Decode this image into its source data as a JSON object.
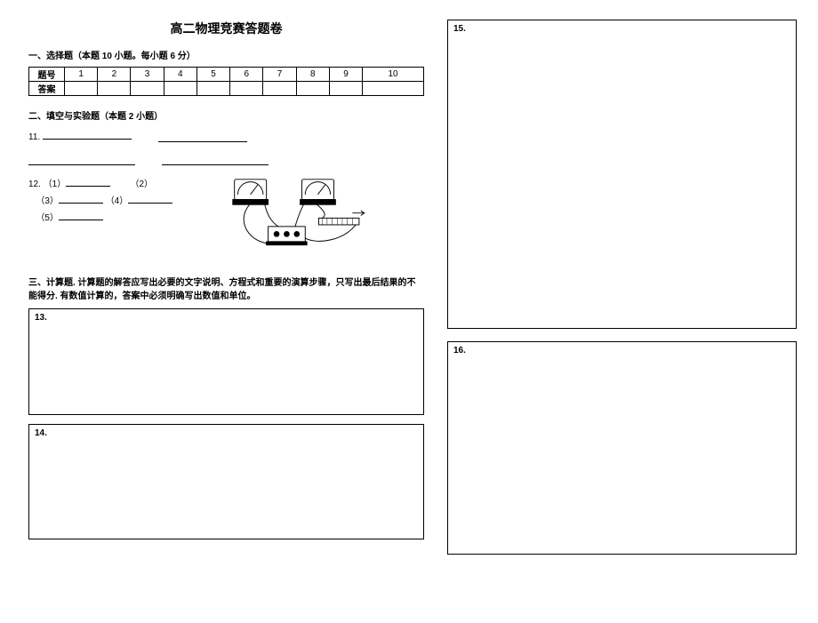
{
  "title": "高二物理竞赛答题卷",
  "section1": {
    "heading": "一、选择题（本题 10 小题。每小题 6 分）",
    "row_label": "题号",
    "answer_label": "答案",
    "cols": [
      "1",
      "2",
      "3",
      "4",
      "5",
      "6",
      "7",
      "8",
      "9",
      "10"
    ]
  },
  "section2": {
    "heading": "二、填空与实验题（本题 2 小题）",
    "q11_label": "11.",
    "q12": {
      "label": "12.",
      "p1": "（1）",
      "p2": "（2）",
      "p3": "（3）",
      "p4": "（4）",
      "p5": "（5）"
    }
  },
  "section3": {
    "heading": "三、计算题. 计算题的解答应写出必要的文字说明、方程式和重要的演算步骤，只写出最后结果的不能得分. 有数值计算的，答案中必须明确写出数值和单位。",
    "q13": "13.",
    "q14": "14.",
    "q15": "15.",
    "q16": "16."
  }
}
